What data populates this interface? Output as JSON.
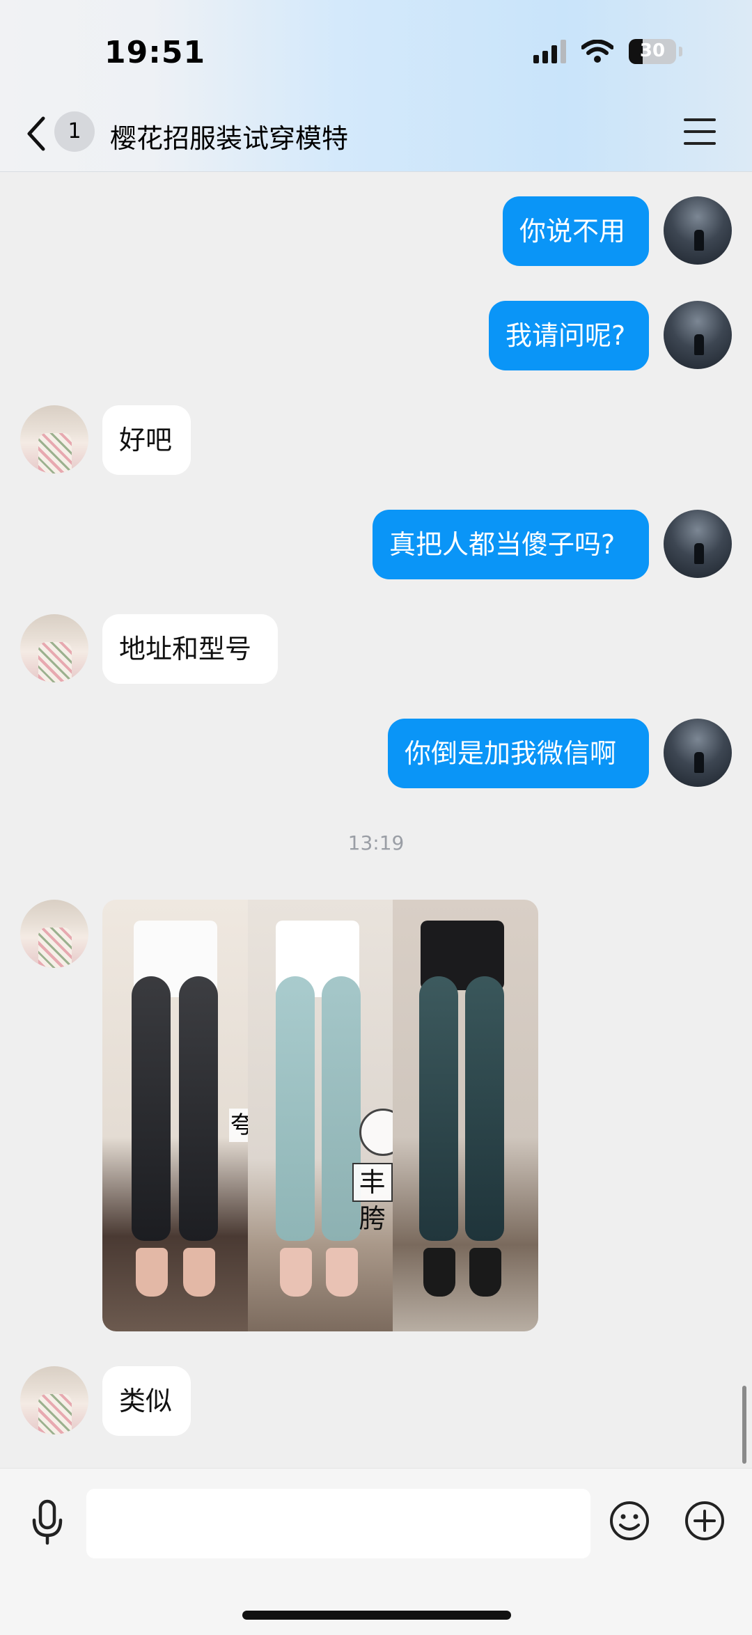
{
  "status_bar": {
    "time": "19:51",
    "battery": "30",
    "battery_level_percent": 30
  },
  "header": {
    "unread_count": "1",
    "title": "樱花招服装试穿模特"
  },
  "messages": [
    {
      "side": "out",
      "text": "你说不用"
    },
    {
      "side": "out",
      "text": "我请问呢?"
    },
    {
      "side": "in",
      "text": "好吧"
    },
    {
      "side": "out",
      "text": "真把人都当傻子吗?"
    },
    {
      "side": "in",
      "text": "地址和型号"
    },
    {
      "side": "out",
      "text": "你倒是加我微信啊"
    }
  ],
  "timestamp": "13:19",
  "image_message": {
    "overlay_text": "丰胯",
    "partial_text": "夸"
  },
  "last_message": {
    "side": "in",
    "text": "类似"
  },
  "input": {
    "value": "",
    "placeholder": ""
  },
  "colors": {
    "outgoing_bubble": "#0a95f7",
    "incoming_bubble": "#ffffff",
    "background": "#efefef"
  },
  "icons": [
    "back-icon",
    "menu-icon",
    "signal-icon",
    "wifi-icon",
    "battery-icon",
    "microphone-icon",
    "emoji-icon",
    "plus-icon"
  ]
}
